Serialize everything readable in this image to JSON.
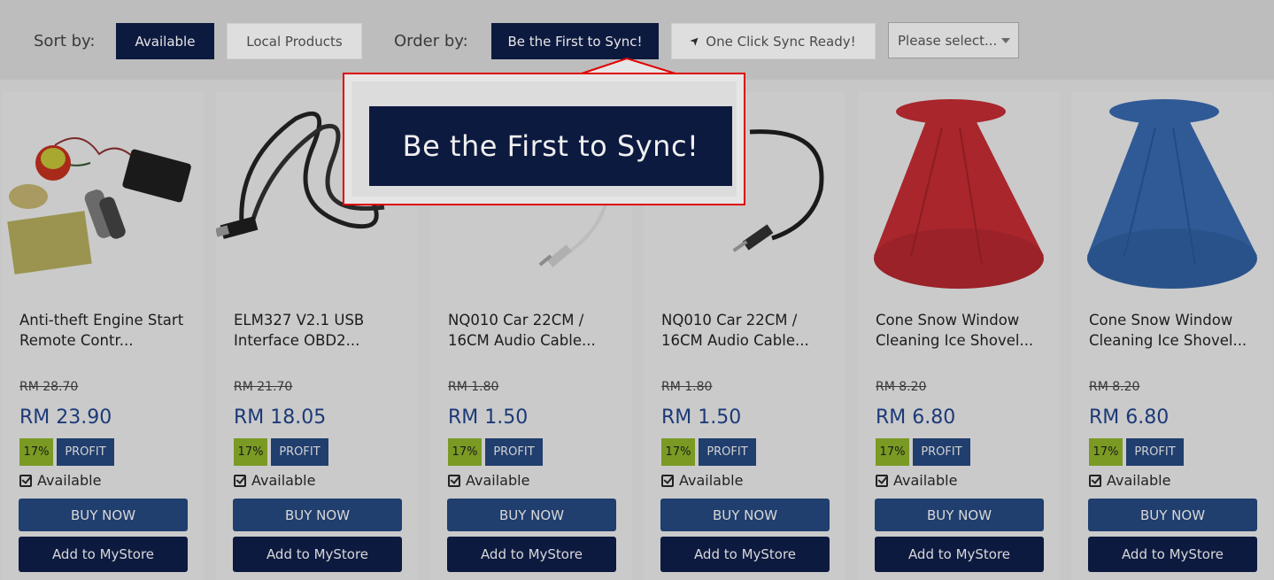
{
  "toolbar": {
    "sort_label": "Sort by:",
    "sort_available": "Available",
    "sort_local": "Local Products",
    "order_label": "Order by:",
    "order_first": "Be the First to Sync!",
    "order_oneclick": "One Click Sync Ready!",
    "select_placeholder": "Please select..."
  },
  "callout": {
    "label": "Be the First to Sync!"
  },
  "colors": {
    "dark_navy": "#0d1a40",
    "navy": "#203e6e",
    "green": "#7a9a24",
    "highlight_red": "#e00000"
  },
  "products": [
    {
      "title": "Anti-theft Engine Start Remote Contr...",
      "old_price": "RM 28.70",
      "price": "RM 23.90",
      "percent": "17%",
      "profit": "PROFIT",
      "available": "Available",
      "buy": "BUY NOW",
      "add": "Add to MyStore"
    },
    {
      "title": "ELM327 V2.1 USB Interface OBD2...",
      "old_price": "RM 21.70",
      "price": "RM 18.05",
      "percent": "17%",
      "profit": "PROFIT",
      "available": "Available",
      "buy": "BUY NOW",
      "add": "Add to MyStore"
    },
    {
      "title": "NQ010 Car 22CM / 16CM Audio Cable...",
      "old_price": "RM 1.80",
      "price": "RM 1.50",
      "percent": "17%",
      "profit": "PROFIT",
      "available": "Available",
      "buy": "BUY NOW",
      "add": "Add to MyStore"
    },
    {
      "title": "NQ010 Car 22CM / 16CM Audio Cable...",
      "old_price": "RM 1.80",
      "price": "RM 1.50",
      "percent": "17%",
      "profit": "PROFIT",
      "available": "Available",
      "buy": "BUY NOW",
      "add": "Add to MyStore"
    },
    {
      "title": "Cone Snow Window Cleaning Ice Shovel...",
      "old_price": "RM 8.20",
      "price": "RM 6.80",
      "percent": "17%",
      "profit": "PROFIT",
      "available": "Available",
      "buy": "BUY NOW",
      "add": "Add to MyStore"
    },
    {
      "title": "Cone Snow Window Cleaning Ice Shovel...",
      "old_price": "RM 8.20",
      "price": "RM 6.80",
      "percent": "17%",
      "profit": "PROFIT",
      "available": "Available",
      "buy": "BUY NOW",
      "add": "Add to MyStore"
    }
  ]
}
